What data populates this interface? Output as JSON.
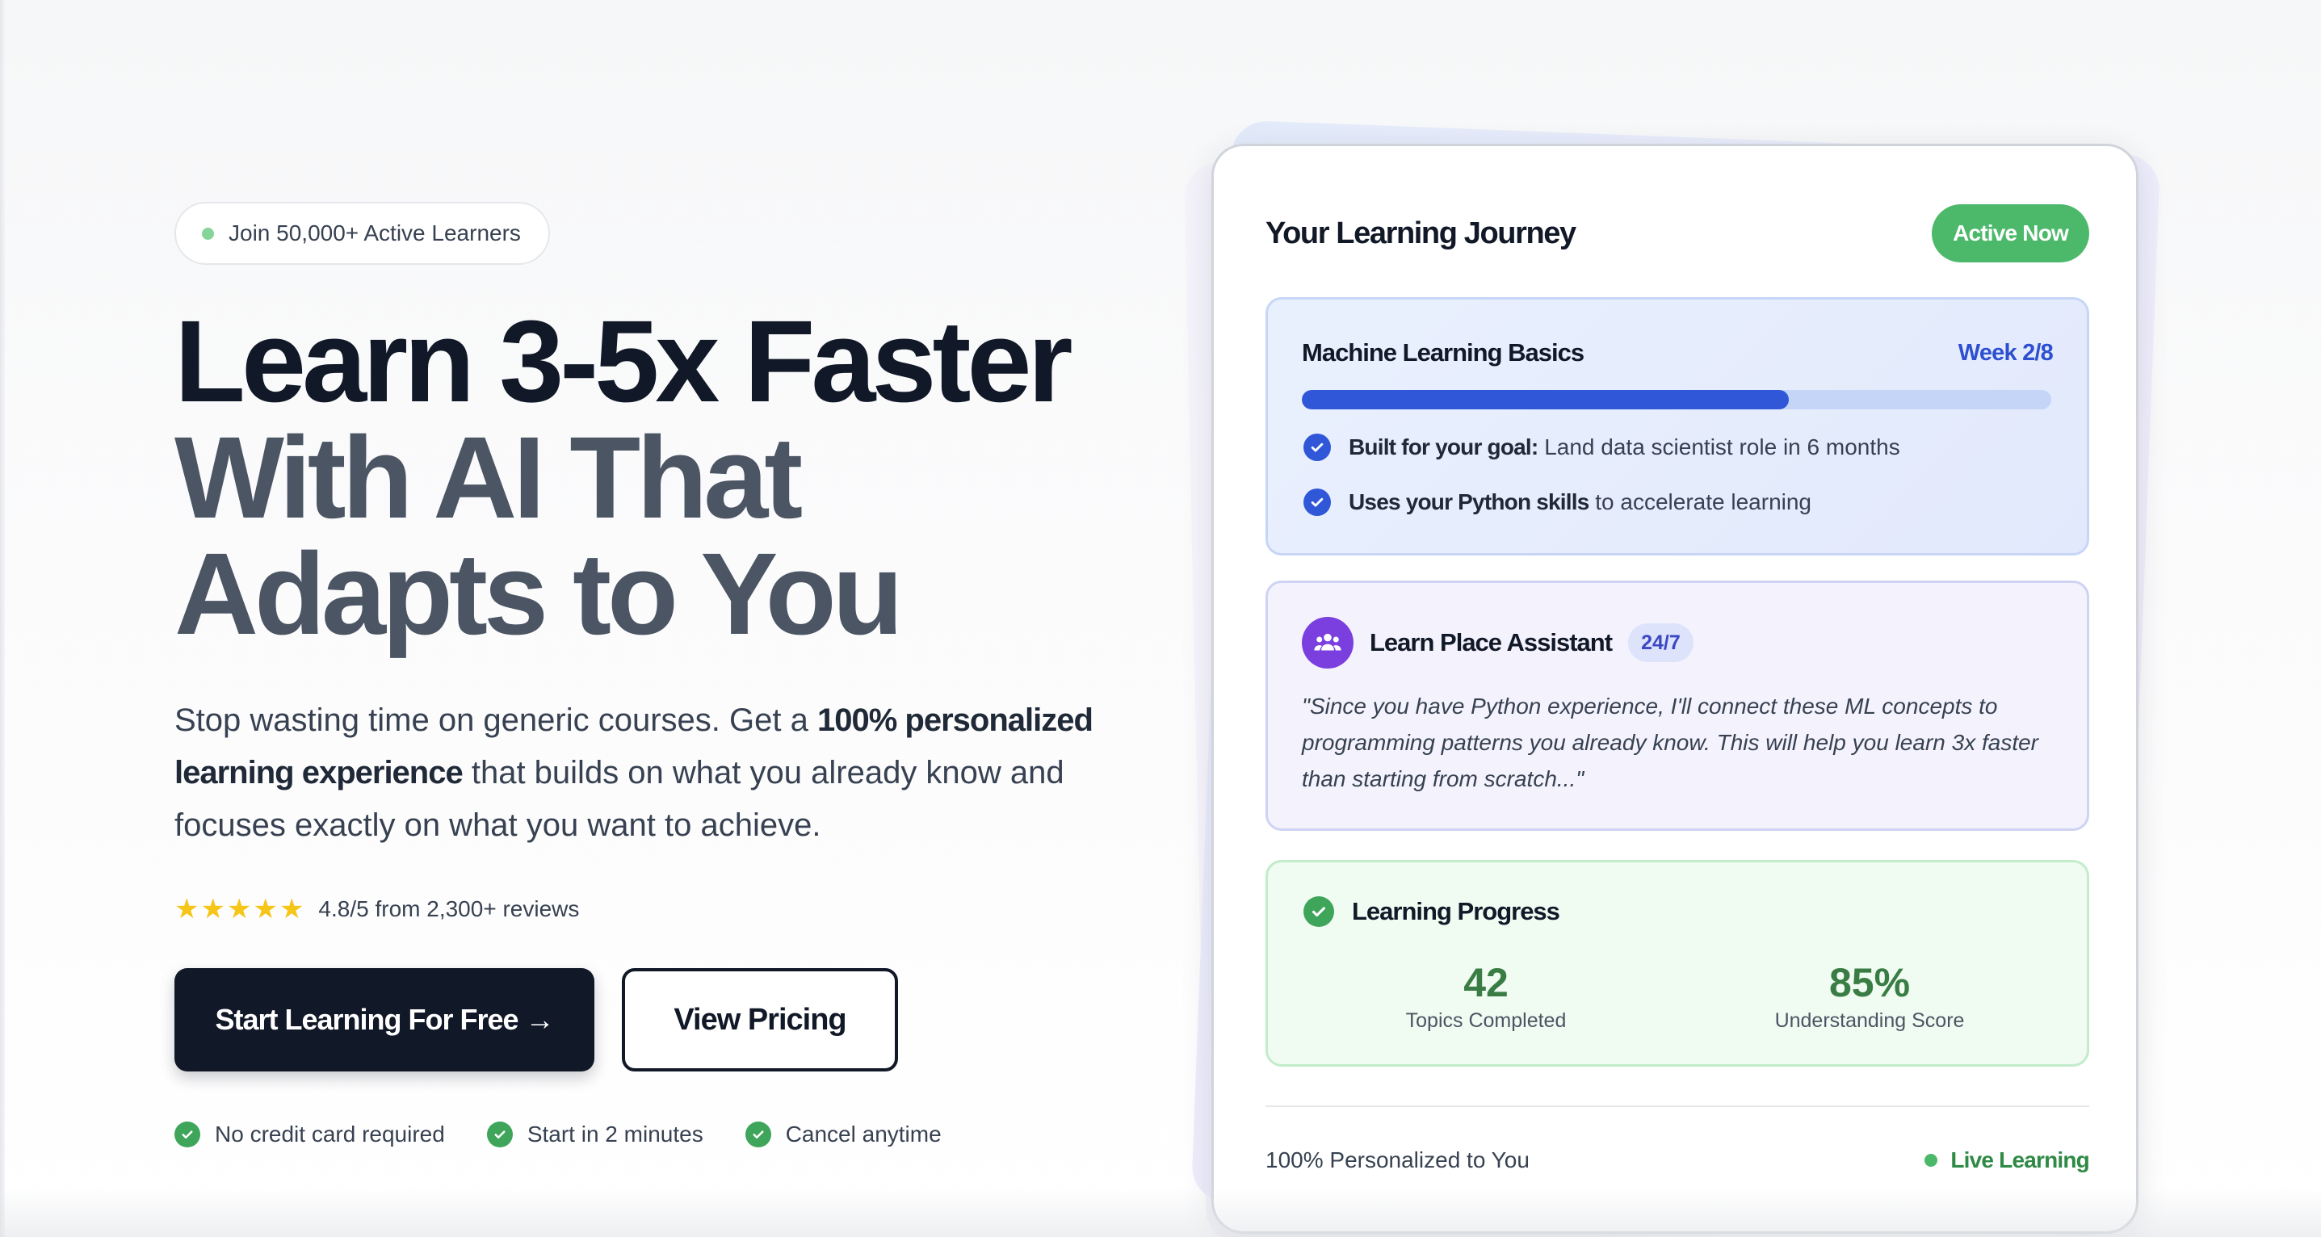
{
  "hero": {
    "badge_text": "Join 50,000+ Active Learners",
    "headline_line1": "Learn 3-5x Faster",
    "headline_line2": "With AI That",
    "headline_line3": "Adapts to You",
    "lead_part1": "Stop wasting time on generic courses. Get a ",
    "lead_bold": "100% personalized learning experience",
    "lead_part2": " that builds on what you already know and focuses exactly on what you want to achieve.",
    "rating_text": "4.8/5 from 2,300+ reviews",
    "rating_stars": 5,
    "primary_button": "Start Learning For Free →",
    "secondary_button": "View Pricing",
    "perks": [
      "No credit card required",
      "Start in 2 minutes",
      "Cancel anytime"
    ]
  },
  "card": {
    "title": "Your Learning Journey",
    "status_pill": "Active Now",
    "course": {
      "name": "Machine Learning Basics",
      "week": "Week 2/8",
      "progress_fraction": 0.65,
      "checks": [
        {
          "bold": "Built for your goal:",
          "text": " Land data scientist role in 6 months"
        },
        {
          "bold": "Uses your Python skills",
          "text": " to accelerate learning"
        }
      ]
    },
    "assistant": {
      "name": "Learn Place Assistant",
      "badge": "24/7",
      "quote": "\"Since you have Python experience, I'll connect these ML concepts to programming patterns you already know. This will help you learn 3x faster than starting from scratch...\""
    },
    "progress": {
      "title": "Learning Progress",
      "topics_value": "42",
      "topics_label": "Topics Completed",
      "score_value": "85%",
      "score_label": "Understanding Score"
    },
    "footer_left": "100% Personalized to You",
    "footer_right": "Live Learning"
  },
  "colors": {
    "primary_dark": "#111827",
    "accent_blue": "#2f57d8",
    "accent_green": "#4cb86a",
    "accent_purple": "#7b3fe0",
    "star": "#f5c518"
  }
}
